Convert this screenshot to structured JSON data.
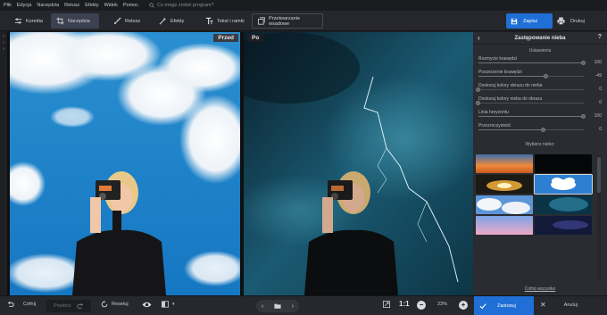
{
  "menu": {
    "items": [
      "Plik",
      "Edycja",
      "Narzędzia",
      "Retusz",
      "Efekty",
      "Widok",
      "Pomoc"
    ],
    "search_placeholder": "Co mogę zrobić program?"
  },
  "toolbar": {
    "korekta": "Korekta",
    "narzedzia": "Narzędzia",
    "retusz": "Retusz",
    "efekty": "Efekty",
    "tekst": "Tekst i ramki",
    "wsadowe": "Przetwarzanie wsadowe",
    "save": "Zapisz",
    "print": "Drukuj"
  },
  "canvas": {
    "before_label": "Przed",
    "after_label": "Po"
  },
  "panel": {
    "title": "Zastępowanie nieba",
    "help": "?",
    "settings_title": "Ustawienia",
    "sliders": [
      {
        "label": "Rozmycie krawędzi",
        "value": "100",
        "level": 1.0
      },
      {
        "label": "Poszerzenie krawędzi",
        "value": "-49",
        "level": 0.64
      },
      {
        "label": "Dostosuj kolory obrazu do nieba",
        "value": "0",
        "level": 0.0
      },
      {
        "label": "Dostosuj kolory nieba do obrazu",
        "value": "0",
        "level": 0.0
      },
      {
        "label": "Linia horyzontu",
        "value": "100",
        "level": 1.0
      },
      {
        "label": "Przezroczystość",
        "value": "0",
        "level": 0.62
      }
    ],
    "sky_title": "Wybierz niebo:",
    "cancel_all": "Cofnij wszystko"
  },
  "bottombar": {
    "undo": "Cofnij",
    "redo": "Powtórz",
    "reset": "Resetuj",
    "zoom_ratio": "1:1",
    "zoom_percent": "23%",
    "apply": "Zastosuj",
    "cancel": "Anuluj"
  },
  "colors": {
    "accent": "#1f6fd6",
    "panel_bg": "#2a2c31",
    "toolbar_bg": "#25272c"
  }
}
